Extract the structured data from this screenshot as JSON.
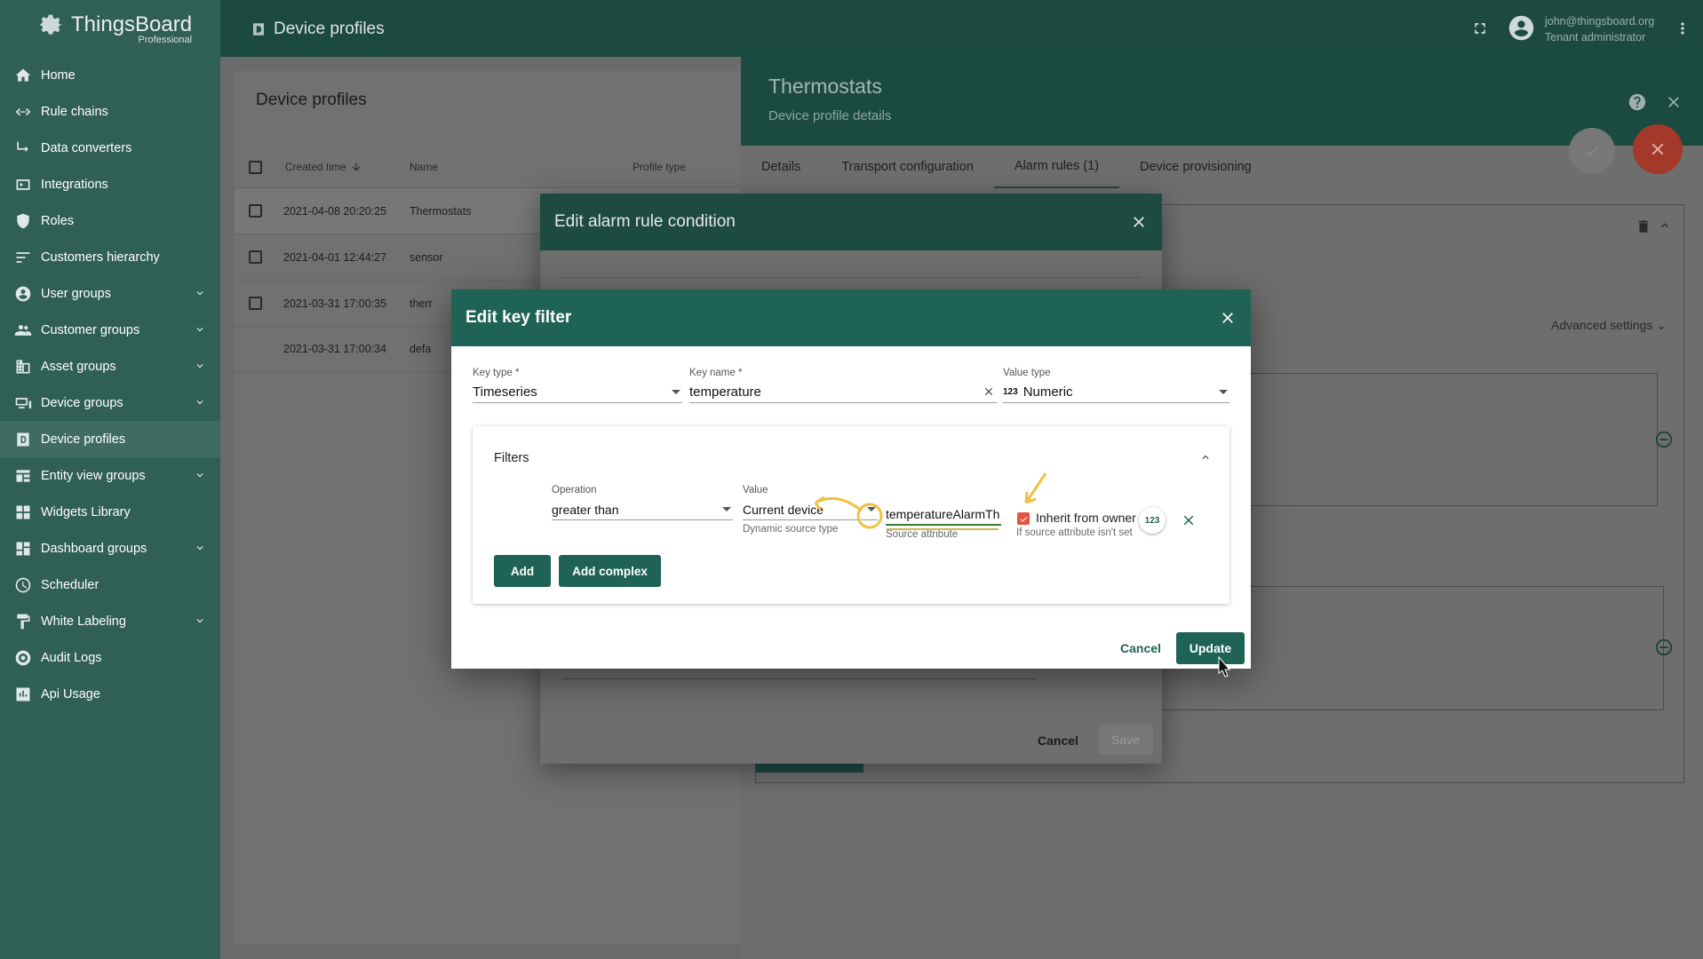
{
  "brand": {
    "name": "ThingsBoard",
    "edition": "Professional"
  },
  "topbar": {
    "title": "Device profiles",
    "user_email": "john@thingsboard.org",
    "user_role": "Tenant administrator"
  },
  "sidebar": {
    "items": [
      {
        "label": "Home",
        "icon": "home-icon",
        "expandable": false
      },
      {
        "label": "Rule chains",
        "icon": "rule-chain-icon",
        "expandable": false
      },
      {
        "label": "Data converters",
        "icon": "converter-icon",
        "expandable": false
      },
      {
        "label": "Integrations",
        "icon": "integration-icon",
        "expandable": false
      },
      {
        "label": "Roles",
        "icon": "shield-icon",
        "expandable": false
      },
      {
        "label": "Customers hierarchy",
        "icon": "hierarchy-icon",
        "expandable": false
      },
      {
        "label": "User groups",
        "icon": "user-icon",
        "expandable": true
      },
      {
        "label": "Customer groups",
        "icon": "group-icon",
        "expandable": true
      },
      {
        "label": "Asset groups",
        "icon": "asset-icon",
        "expandable": true
      },
      {
        "label": "Device groups",
        "icon": "device-icon",
        "expandable": true
      },
      {
        "label": "Device profiles",
        "icon": "device-profile-icon",
        "expandable": false,
        "active": true
      },
      {
        "label": "Entity view groups",
        "icon": "entity-view-icon",
        "expandable": true
      },
      {
        "label": "Widgets Library",
        "icon": "widgets-icon",
        "expandable": false
      },
      {
        "label": "Dashboard groups",
        "icon": "dashboard-icon",
        "expandable": true
      },
      {
        "label": "Scheduler",
        "icon": "clock-icon",
        "expandable": false
      },
      {
        "label": "White Labeling",
        "icon": "paint-roller-icon",
        "expandable": true
      },
      {
        "label": "Audit Logs",
        "icon": "audit-icon",
        "expandable": false
      },
      {
        "label": "Api Usage",
        "icon": "chart-icon",
        "expandable": false
      }
    ]
  },
  "profiles_card": {
    "title": "Device profiles",
    "columns": [
      "Created time",
      "Name",
      "Profile type"
    ],
    "rows": [
      {
        "created": "2021-04-08 20:20:25",
        "name": "Thermostats"
      },
      {
        "created": "2021-04-01 12:44:27",
        "name": "sensor"
      },
      {
        "created": "2021-03-31 17:00:35",
        "name": "therr"
      },
      {
        "created": "2021-03-31 17:00:34",
        "name": "defa"
      }
    ]
  },
  "details": {
    "title": "Thermostats",
    "subtitle": "Device profile details",
    "tabs": [
      "Details",
      "Transport configuration",
      "Alarm rules (1)",
      "Device provisioning"
    ],
    "advanced_settings": "Advanced settings"
  },
  "alarm_dialog": {
    "title": "Edit alarm rule condition",
    "cancel": "Cancel",
    "save": "Save"
  },
  "key_filter": {
    "title": "Edit key filter",
    "key_type_label": "Key type *",
    "key_type": "Timeseries",
    "key_name_label": "Key name *",
    "key_name": "temperature",
    "value_type_label": "Value type",
    "value_type_icon": "123",
    "value_type": "Numeric",
    "filters_title": "Filters",
    "operation_label": "Operation",
    "operation": "greater than",
    "value_label": "Value",
    "value": "Current device",
    "value_hint": "Dynamic source type",
    "source_attribute": "temperatureAlarmTh",
    "source_attribute_hint": "Source attribute",
    "inherit_label": "Inherit from owner",
    "inherit_hint": "If source attribute isn't set",
    "num_badge": "123",
    "add": "Add",
    "add_complex": "Add complex",
    "cancel": "Cancel",
    "update": "Update"
  },
  "colors": {
    "primary": "#1f6357",
    "sidebar": "#305f55",
    "fab": "#d44a3a",
    "checkbox": "#e2553f",
    "annotation": "#f0c040"
  }
}
